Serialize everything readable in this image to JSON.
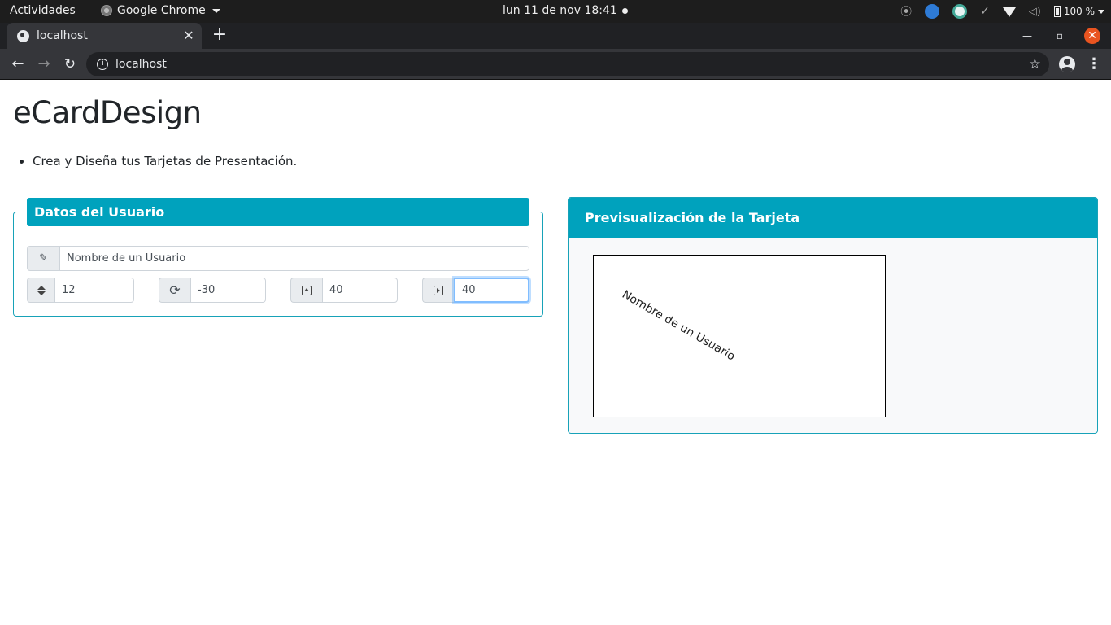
{
  "system": {
    "activities": "Actividades",
    "app_name": "Google Chrome",
    "clock": "lun 11 de nov  18:41",
    "battery": "100 %"
  },
  "browser": {
    "tab_title": "localhost",
    "url": "localhost"
  },
  "page": {
    "title": "eCardDesign",
    "bullets": [
      "Crea y Diseña tus Tarjetas de Presentación."
    ],
    "user_panel": {
      "legend": "Datos del Usuario",
      "name_value": "Nombre de un Usuario",
      "font_size_value": "12",
      "rotation_value": "-30",
      "top_value": "40",
      "left_value": "40"
    },
    "preview_panel": {
      "header": "Previsualización de la Tarjeta",
      "card_text": "Nombre de un Usuario"
    }
  },
  "colors": {
    "accent": "#00a2bd",
    "border": "#17a2b8"
  },
  "icons": {
    "name": "pencil-icon",
    "font_size": "sort-icon",
    "rotation": "refresh-icon",
    "top": "caret-square-up-icon",
    "left": "caret-square-right-icon"
  }
}
